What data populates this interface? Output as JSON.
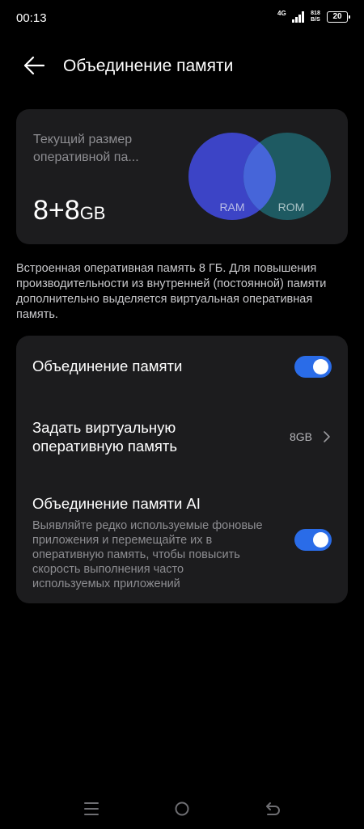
{
  "status": {
    "time": "00:13",
    "network": "4G",
    "speed_value": "818",
    "speed_unit": "B/S",
    "battery": "20"
  },
  "header": {
    "title": "Объединение памяти",
    "back_icon": "arrow-left-icon"
  },
  "memory_card": {
    "label": "Текущий размер оперативной па...",
    "value": "8+8",
    "unit": "GB",
    "venn": {
      "left_label": "RAM",
      "right_label": "ROM"
    },
    "colors": {
      "ram": "#3c44c6",
      "rom": "#1e5a62",
      "overlap": "#4665d9"
    }
  },
  "description": "Встроенная оперативная память 8 ГБ. Для повышения производительности из внутренней (постоянной) памяти дополнительно выделяется виртуальная оперативная память.",
  "settings": {
    "memory_merge": {
      "title": "Объединение памяти",
      "enabled": true
    },
    "virtual_ram": {
      "title": "Задать виртуальную оперативную память",
      "value": "8GB"
    },
    "ai_merge": {
      "title": "Объединение памяти AI",
      "subtitle": "Выявляйте редко используемые фоновые приложения и перемещайте их в оперативную память, чтобы повысить скорость выполнения часто используемых приложений",
      "enabled": true
    }
  },
  "accent_color": "#2a6ce8",
  "nav": {
    "icons": [
      "menu-icon",
      "home-icon",
      "back-icon"
    ]
  }
}
